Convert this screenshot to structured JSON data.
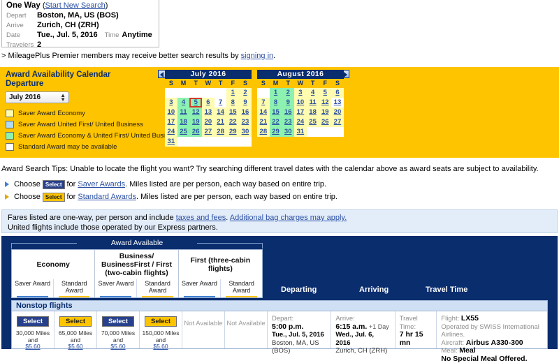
{
  "trip": {
    "type_label": "One Way",
    "new_search_link": "Start New Search",
    "depart_label": "Depart",
    "depart_value": "Boston, MA, US (BOS)",
    "arrive_label": "Arrive",
    "arrive_value": "Zurich, CH (ZRH)",
    "date_label": "Date",
    "date_value": "Tue., Jul. 5, 2016",
    "time_label": "Time",
    "time_value": "Anytime",
    "travelers_label": "Travelers",
    "travelers_value": "2"
  },
  "mileageplus_notice": {
    "prefix": "> MileagePlus Premier members may receive better search results by ",
    "link": "signing in",
    "suffix": "."
  },
  "calendar": {
    "title_line1": "Award Availability Calendar",
    "title_line2": "Departure",
    "month_select_value": "July 2016",
    "prev_icon": "left-arrow-icon",
    "next_icon": "right-arrow-icon",
    "legend": [
      {
        "color": "#FFFBAF",
        "label": "Saver Award Economy"
      },
      {
        "color": "#AEDAF5",
        "label": "Saver Award United First/ United Business"
      },
      {
        "color": "#8DF2B0",
        "label": "Saver Award Economy & United First/ United Business"
      },
      {
        "color": "#FFFFFF",
        "label": "Standard Award may be available"
      }
    ],
    "dow": [
      "S",
      "M",
      "T",
      "W",
      "T",
      "F",
      "S"
    ],
    "months": [
      {
        "name": "July  2016",
        "lead_blanks": 5,
        "days": [
          {
            "n": 1,
            "s": "yellow"
          },
          {
            "n": 2,
            "s": "yellow"
          },
          {
            "n": 3,
            "s": "yellow"
          },
          {
            "n": 4,
            "s": "green"
          },
          {
            "n": 5,
            "s": "green",
            "selected": true
          },
          {
            "n": 6,
            "s": "yellow"
          },
          {
            "n": 7,
            "s": "white"
          },
          {
            "n": 8,
            "s": "yellow"
          },
          {
            "n": 9,
            "s": "yellow"
          },
          {
            "n": 10,
            "s": "yellow"
          },
          {
            "n": 11,
            "s": "green"
          },
          {
            "n": 12,
            "s": "green"
          },
          {
            "n": 13,
            "s": "yellow"
          },
          {
            "n": 14,
            "s": "yellow"
          },
          {
            "n": 15,
            "s": "yellow"
          },
          {
            "n": 16,
            "s": "yellow"
          },
          {
            "n": 17,
            "s": "yellow"
          },
          {
            "n": 18,
            "s": "green"
          },
          {
            "n": 19,
            "s": "green"
          },
          {
            "n": 20,
            "s": "yellow"
          },
          {
            "n": 21,
            "s": "yellow"
          },
          {
            "n": 22,
            "s": "yellow"
          },
          {
            "n": 23,
            "s": "yellow"
          },
          {
            "n": 24,
            "s": "yellow"
          },
          {
            "n": 25,
            "s": "green"
          },
          {
            "n": 26,
            "s": "green"
          },
          {
            "n": 27,
            "s": "yellow"
          },
          {
            "n": 28,
            "s": "yellow"
          },
          {
            "n": 29,
            "s": "yellow"
          },
          {
            "n": 30,
            "s": "yellow"
          },
          {
            "n": 31,
            "s": "yellow"
          }
        ]
      },
      {
        "name": "August  2016",
        "lead_blanks": 1,
        "days": [
          {
            "n": 1,
            "s": "green"
          },
          {
            "n": 2,
            "s": "green"
          },
          {
            "n": 3,
            "s": "yellow"
          },
          {
            "n": 4,
            "s": "yellow"
          },
          {
            "n": 5,
            "s": "yellow"
          },
          {
            "n": 6,
            "s": "yellow"
          },
          {
            "n": 7,
            "s": "yellow"
          },
          {
            "n": 8,
            "s": "green"
          },
          {
            "n": 9,
            "s": "green"
          },
          {
            "n": 10,
            "s": "yellow"
          },
          {
            "n": 11,
            "s": "yellow"
          },
          {
            "n": 12,
            "s": "yellow"
          },
          {
            "n": 13,
            "s": "white"
          },
          {
            "n": 14,
            "s": "yellow"
          },
          {
            "n": 15,
            "s": "green"
          },
          {
            "n": 16,
            "s": "green"
          },
          {
            "n": 17,
            "s": "yellow"
          },
          {
            "n": 18,
            "s": "yellow"
          },
          {
            "n": 19,
            "s": "yellow"
          },
          {
            "n": 20,
            "s": "yellow"
          },
          {
            "n": 21,
            "s": "yellow"
          },
          {
            "n": 22,
            "s": "green"
          },
          {
            "n": 23,
            "s": "green"
          },
          {
            "n": 24,
            "s": "yellow"
          },
          {
            "n": 25,
            "s": "yellow"
          },
          {
            "n": 26,
            "s": "yellow"
          },
          {
            "n": 27,
            "s": "yellow"
          },
          {
            "n": 28,
            "s": "yellow"
          },
          {
            "n": 29,
            "s": "green"
          },
          {
            "n": 30,
            "s": "green"
          },
          {
            "n": 31,
            "s": "yellow"
          }
        ]
      }
    ]
  },
  "tips": {
    "heading": "Award Search Tips: Unable to locate the flight you want? Try searching different travel dates with the calendar above as award seats are subject to availability.",
    "rows": [
      {
        "pre": "Choose",
        "button": "Select",
        "mid": "for",
        "link": "Saver Awards",
        "post": ". Miles listed are per person, each way based on entire trip."
      },
      {
        "pre": "Choose",
        "button": "Select",
        "mid": "for",
        "link": "Standard Awards",
        "post": ". Miles listed are per person, each way based on entire trip."
      }
    ]
  },
  "fares_note": {
    "line1_pre": "Fares listed are one-way, per person and include ",
    "line1_link1": "taxes and fees",
    "line1_mid": ". ",
    "line1_link2": "Additional bag charges may apply.",
    "line2": "United flights include those operated by our Express partners."
  },
  "results": {
    "award_available_label": "Award Available",
    "cabins": [
      {
        "name": "Economy",
        "sub": [
          "Saver Award",
          "Standard Award"
        ]
      },
      {
        "name": "Business/ BusinessFirst / First (two-cabin flights)",
        "sub": [
          "Saver Award",
          "Standard Award"
        ]
      },
      {
        "name": "First (three-cabin flights)",
        "sub": [
          "Saver Award",
          "Standard Award"
        ]
      }
    ],
    "columns": {
      "departing": "Departing",
      "arriving": "Arriving",
      "travel_time": "Travel Time"
    },
    "section_label": "Nonstop flights",
    "fares": [
      {
        "button": "Select",
        "style": "blue",
        "miles": "30,000 Miles",
        "and": "and",
        "price": "$5.60"
      },
      {
        "button": "Select",
        "style": "gold",
        "miles": "65,000 Miles",
        "and": "and",
        "price": "$5.60"
      },
      {
        "button": "Select",
        "style": "blue",
        "miles": "70,000 Miles",
        "and": "and",
        "price": "$5.60"
      },
      {
        "button": "Select",
        "style": "gold",
        "miles": "150,000 Miles",
        "and": "and",
        "price": "$5.60"
      }
    ],
    "not_available_label": "Not Available",
    "not_available_count": 2,
    "flight": {
      "depart_label": "Depart:",
      "depart_time": "5:00 p.m.",
      "depart_date": "Tue., Jul. 5, 2016",
      "depart_city": "Boston, MA, US (BOS)",
      "arrive_label": "Arrive:",
      "arrive_time": "6:15 a.m.",
      "arrive_plusday": "+1 Day",
      "arrive_date": "Wed., Jul. 6, 2016",
      "arrive_city": "Zurich, CH (ZRH)",
      "travel_time_label": "Travel Time:",
      "travel_time_value": "7 hr 15 mn",
      "flight_label": "Flight:",
      "flight_number": "LX55",
      "operated_by": "Operated by SWISS International Airlines.",
      "aircraft_label": "Aircraft:",
      "aircraft_value": "Airbus A330-300",
      "meal_label": "Meal:",
      "meal_value": "Meal",
      "special_meal": "No Special Meal Offered."
    }
  }
}
